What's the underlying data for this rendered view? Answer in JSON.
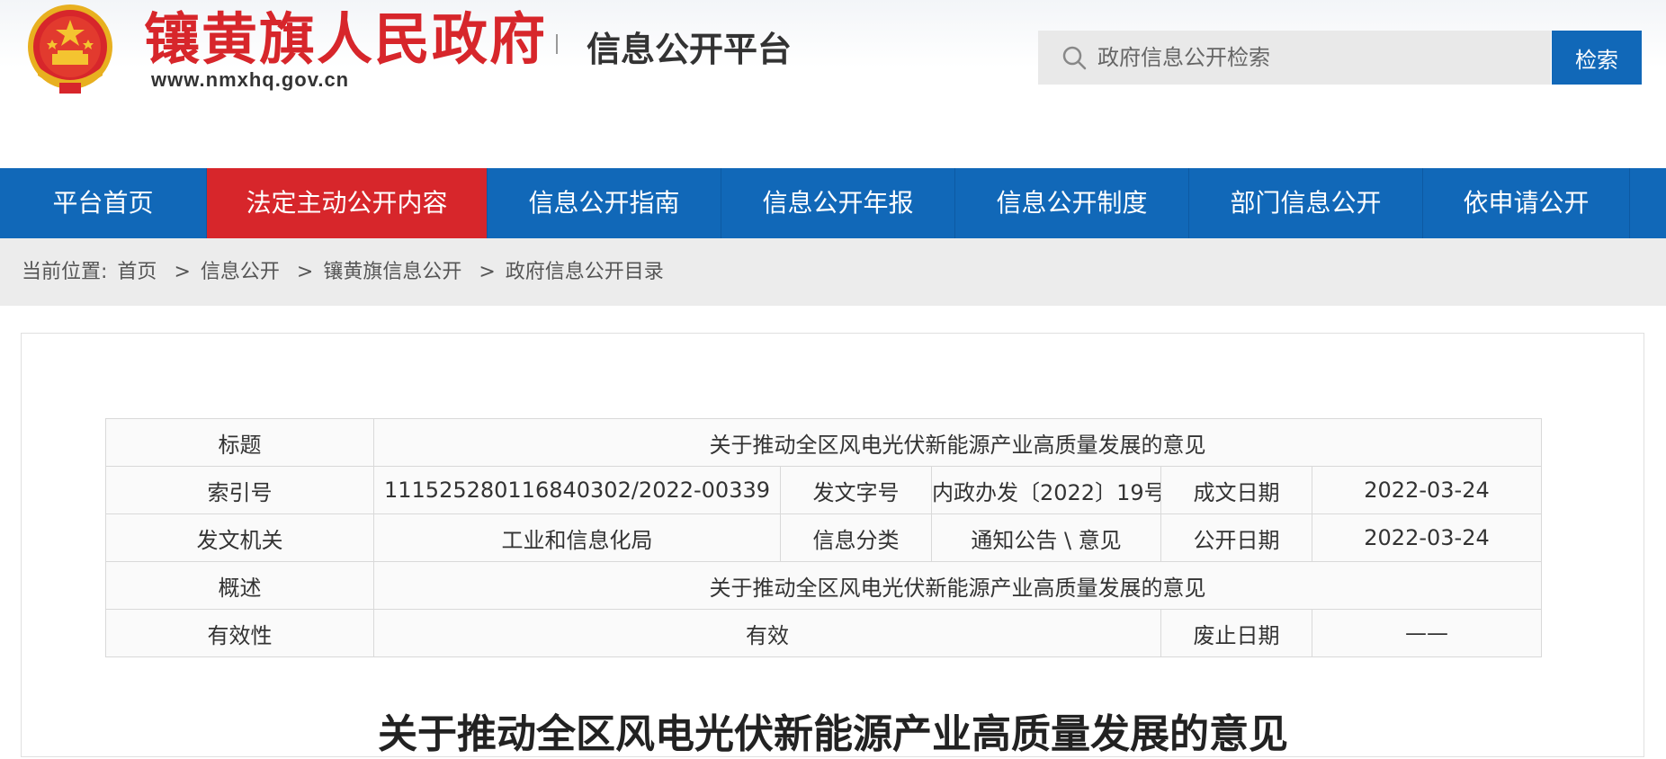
{
  "header": {
    "site_name": "镶黄旗人民政府",
    "site_url": "www.nmxhq.gov.cn",
    "platform_title": "信息公开平台",
    "search_placeholder": "政府信息公开检索",
    "search_button": "检索"
  },
  "nav": {
    "items": [
      {
        "label": "平台首页"
      },
      {
        "label": "法定主动公开内容"
      },
      {
        "label": "信息公开指南"
      },
      {
        "label": "信息公开年报"
      },
      {
        "label": "信息公开制度"
      },
      {
        "label": "部门信息公开"
      },
      {
        "label": "依申请公开"
      }
    ]
  },
  "breadcrumb": {
    "prefix": "当前位置:",
    "items": [
      "首页",
      "信息公开",
      "镶黄旗信息公开",
      "政府信息公开目录"
    ],
    "separator": ">"
  },
  "meta_table": {
    "title_label": "标题",
    "title_value": "关于推动全区风电光伏新能源产业高质量发展的意见",
    "index_label": "索引号",
    "index_value": "111525280116840302/2022-00339",
    "doc_no_label": "发文字号",
    "doc_no_value": "内政办发〔2022〕19号",
    "date_label": "成文日期",
    "date_value": "2022-03-24",
    "issuer_label": "发文机关",
    "issuer_value": "工业和信息化局",
    "category_label": "信息分类",
    "category_value": "通知公告 \\ 意见",
    "publish_label": "公开日期",
    "publish_value": "2022-03-24",
    "summary_label": "概述",
    "summary_value": "关于推动全区风电光伏新能源产业高质量发展的意见",
    "validity_label": "有效性",
    "validity_value": "有效",
    "abolish_label": "废止日期",
    "abolish_value": "——"
  },
  "document": {
    "title": "关于推动全区风电光伏新能源产业高质量发展的意见"
  },
  "colors": {
    "brand_blue": "#1168b8",
    "brand_red": "#d7262b"
  }
}
